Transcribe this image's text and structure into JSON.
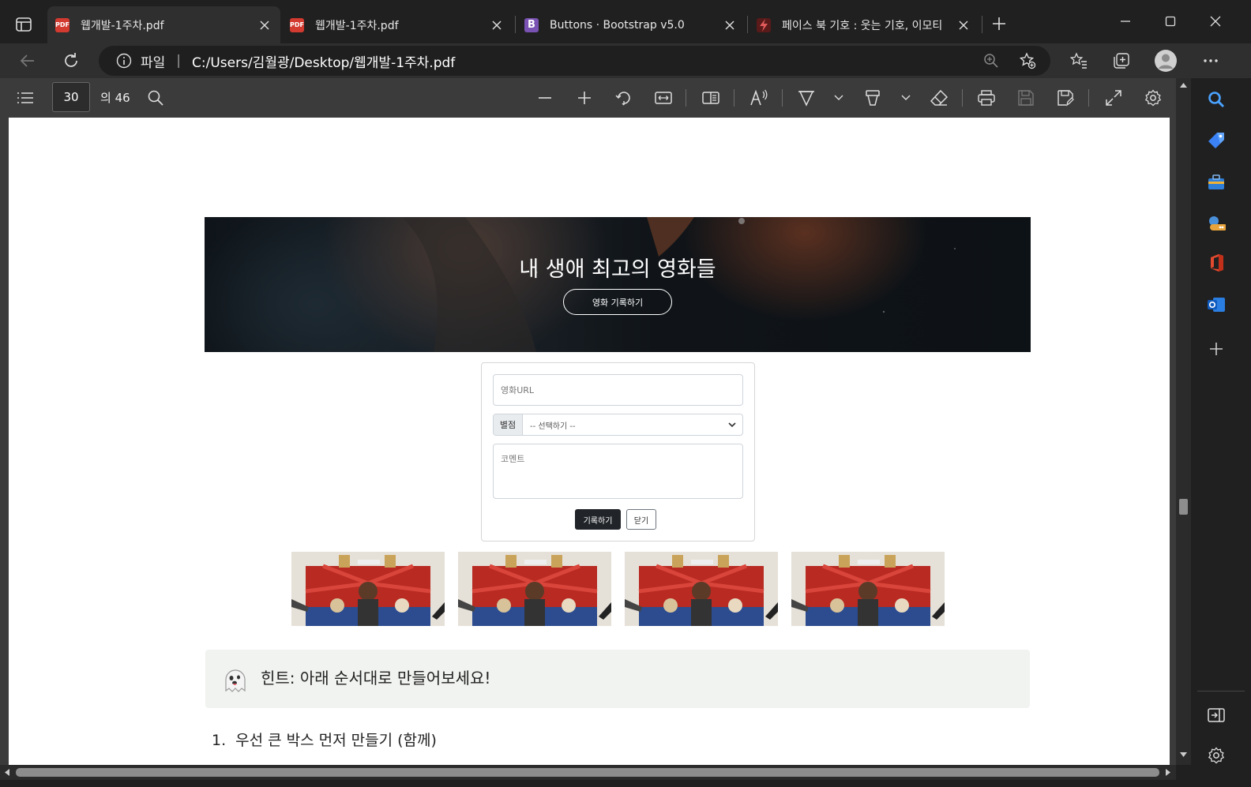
{
  "tabs": [
    {
      "title": "웹개발-1주차.pdf",
      "favicon": "pdf-icon",
      "active": true
    },
    {
      "title": "웹개발-1주차.pdf",
      "favicon": "pdf-icon",
      "active": false
    },
    {
      "title": "Buttons · Bootstrap v5.0",
      "favicon": "bootstrap-icon",
      "favicon_text": "B",
      "active": false
    },
    {
      "title": "페이스 북 기호 : 웃는 기호, 이모티",
      "favicon": "lightning-icon",
      "active": false
    }
  ],
  "address": {
    "scheme_label": "파일",
    "url": "C:/Users/김월광/Desktop/웹개발-1주차.pdf"
  },
  "pdf_toolbar": {
    "current_page": "30",
    "total_pages": "의 46"
  },
  "document": {
    "hero": {
      "title": "내 생애 최고의 영화들",
      "button_label": "영화 기록하기"
    },
    "form": {
      "url_placeholder": "영화URL",
      "rating_label": "별점",
      "rating_selected": "-- 선택하기 --",
      "comment_placeholder": "코멘트",
      "submit_label": "기록하기",
      "close_label": "닫기"
    },
    "hint": {
      "text": "힌트: 아래 순서대로 만들어보세요!"
    },
    "steps": [
      {
        "number": "1.",
        "text": "우선 큰 박스 먼저 만들기 (함께)"
      }
    ]
  },
  "colors": {
    "pdf_red": "#d33a30",
    "bootstrap_purple": "#7952b3",
    "accent_blue": "#4aa3ff"
  }
}
